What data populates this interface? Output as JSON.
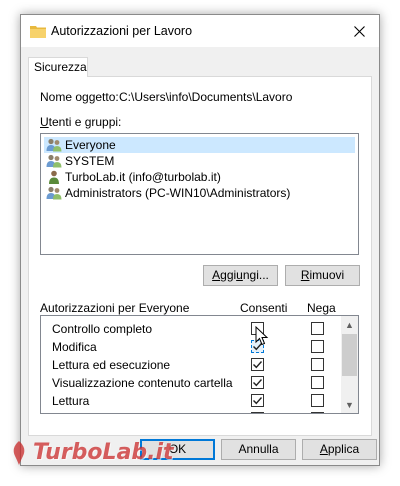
{
  "window": {
    "title": "Autorizzazioni per Lavoro",
    "close_symbol": "✕"
  },
  "tab": {
    "label": "Sicurezza"
  },
  "object": {
    "label": "Nome oggetto:",
    "path": "C:\\Users\\info\\Documents\\Lavoro"
  },
  "users": {
    "label": "Utenti e gruppi:",
    "items": [
      {
        "name": "Everyone",
        "icon": "group-icon",
        "selected": true
      },
      {
        "name": "SYSTEM",
        "icon": "group-icon",
        "selected": false
      },
      {
        "name": "TurboLab.it (info@turbolab.it)",
        "icon": "user-icon",
        "selected": false
      },
      {
        "name": "Administrators (PC-WIN10\\Administrators)",
        "icon": "group-icon",
        "selected": false
      }
    ]
  },
  "buttons": {
    "add": "Aggiungi...",
    "remove": "Rimuovi",
    "ok": "OK",
    "cancel": "Annulla",
    "apply": "Applica"
  },
  "permissions": {
    "label": "Autorizzazioni per Everyone",
    "allow_header": "Consenti",
    "deny_header": "Nega",
    "rows": [
      {
        "name": "Controllo completo",
        "allow": false,
        "deny": false
      },
      {
        "name": "Modifica",
        "allow": true,
        "deny": false
      },
      {
        "name": "Lettura ed esecuzione",
        "allow": true,
        "deny": false
      },
      {
        "name": "Visualizzazione contenuto cartella",
        "allow": true,
        "deny": false
      },
      {
        "name": "Lettura",
        "allow": true,
        "deny": false
      }
    ]
  },
  "watermark": {
    "text": "TurboLab.it"
  },
  "colors": {
    "selection": "#cce8ff",
    "accent": "#0078d7",
    "watermark": "#c82828"
  }
}
